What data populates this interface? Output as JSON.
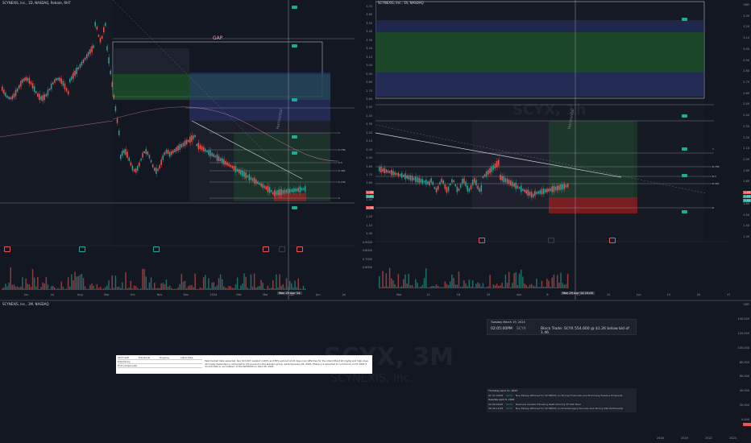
{
  "left_pane": {
    "symbol": "SCYNEXIS, Inc., 1D, NASDAQ, Rebate, RHT",
    "gap_label": "GAP",
    "price_axis": [
      "3.75",
      "3.60",
      "3.50",
      "3.40",
      "3.30",
      "3.20",
      "3.10",
      "3.00",
      "2.90",
      "2.80",
      "2.70",
      "2.60",
      "2.50",
      "2.40",
      "2.30",
      "2.20",
      "2.10",
      "2.00",
      "1.90",
      "1.80",
      "1.70",
      "1.60",
      "1.50",
      "1.40",
      "1.30",
      "1.20",
      "1.10",
      "1.00",
      "0.9000",
      "0.8000",
      "0.7000",
      "0.6000"
    ],
    "time_axis": [
      "Jun",
      "Jul",
      "Aug",
      "Sep",
      "Oct",
      "Nov",
      "Dec",
      "2024",
      "Feb",
      "Mar",
      "Apr",
      "Jun",
      "Jul"
    ],
    "cursor_label": "Mon 29 Apr '24",
    "vertical_label": "Horizontal",
    "fib_labels": [
      "1",
      "0.786",
      "0.5",
      "0.382",
      "0.236",
      "0"
    ],
    "price_tags": [
      "1.46",
      "1.45",
      "1.36"
    ]
  },
  "right_pane": {
    "symbol": "SCYNEXIS, Inc., 1h, NASDAQ",
    "watermark": "SCYX, 1h",
    "price_axis": [
      "USD",
      "3.30",
      "3.20",
      "3.10",
      "3.00",
      "2.90",
      "2.80",
      "2.70",
      "2.60",
      "2.50",
      "2.40",
      "2.30",
      "2.20",
      "2.10",
      "2.00",
      "1.90",
      "1.80",
      "1.70",
      "1.60",
      "1.50",
      "1.40",
      "1.30"
    ],
    "time_axis": [
      "Mar",
      "11",
      "18",
      "25",
      "Apr",
      "8",
      "15",
      "22",
      "Jun",
      "13",
      "20",
      "17"
    ],
    "cursor_label": "Mon 29 Apr '24 15:00",
    "vertical_label": "Horizontal",
    "fib_labels": [
      "1",
      "0.786",
      "0.5",
      "0.382",
      "0"
    ],
    "price_tags": [
      "1.46",
      "1.45",
      "1.40"
    ]
  },
  "bottom_pane": {
    "symbol": "SCYNEXIS, Inc., 3M, NASDAQ",
    "watermark": "SCYX, 3M",
    "watermark_sub": "SCYNEXIS, Inc.",
    "price_axis": [
      "USD",
      "140.000",
      "120.000",
      "100.000",
      "80.000",
      "60.000",
      "40.000",
      "20.000",
      "0.000"
    ],
    "time_axis": [
      "2018",
      "2019",
      "2022",
      "2024"
    ]
  },
  "block_trade": {
    "date": "Tuesday March 19, 2024",
    "time": "02:05:00PM",
    "ticker": "SCYX",
    "text": "Block Trade: SCYX 554,600 @ $1.26 below bid of 1.46"
  },
  "news": {
    "items": [
      {
        "date": "Thursday April 11, 2024",
        "time": "",
        "source": "",
        "headline": ""
      },
      {
        "date": "",
        "time": "01:31:03AM",
        "source": "SCYX",
        "headline": "Buy Rating Affirmed for SCYNEXIS on Strong Financials and Promising Pipeline Prospects"
      },
      {
        "date": "Tuesday April 9, 2024",
        "time": "",
        "source": "",
        "headline": ""
      },
      {
        "date": "",
        "time": "02:09:00AM",
        "source": "SCYX",
        "headline": "Business Update Following Restructuring Of GSK Deal"
      },
      {
        "date": "",
        "time": "06:36:11AM",
        "source": "SCYX",
        "headline": "Buy Rating Affirmed for SCYNEXIS on Ibrexafungerp Success and Strong GSK Partnership"
      }
    ]
  },
  "note": {
    "rows": [
      [
        "SCYX GAP",
        "Preclinical",
        "Ongoing",
        "Initial Data"
      ],
      [
        "Preliminary",
        "",
        "",
        ""
      ],
      [
        "First components",
        "",
        "",
        ""
      ]
    ],
    "body": "Fast-tracked data expected. Key SCY-247 readout in 60% and 85% sell-out at 20 days over effective for the intermittent 20 mg/kg and high-dose 40 mg/kg dependency compared to 4% percent in the placebo group. Added January 05, 2024, Phase 1 is expected to commence in H1 2024 if clinical data is not headed, of the NCT0043 on April 05, 2024"
  },
  "colors": {
    "bg": "#131722",
    "up": "#26a69a",
    "down": "#ef5350",
    "green_zone": "#1b5e20",
    "blue_zone": "#283593"
  }
}
